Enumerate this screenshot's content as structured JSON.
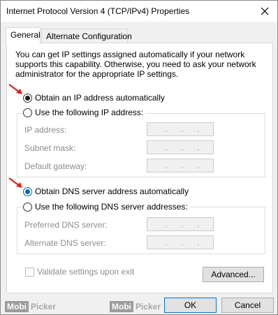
{
  "window": {
    "title": "Internet Protocol Version 4 (TCP/IPv4) Properties",
    "close_icon": "close-icon"
  },
  "tabs": [
    {
      "label": "General",
      "active": true
    },
    {
      "label": "Alternate Configuration",
      "active": false
    }
  ],
  "general": {
    "intro": "You can get IP settings assigned automatically if your network supports this capability. Otherwise, you need to ask your network administrator for the appropriate IP settings.",
    "ip_auto_label": "Obtain an IP address automatically",
    "ip_manual_label": "Use the following IP address:",
    "ip_fields": [
      {
        "label": "IP address:",
        "value": ". . ."
      },
      {
        "label": "Subnet mask:",
        "value": ". . ."
      },
      {
        "label": "Default gateway:",
        "value": ". . ."
      }
    ],
    "dns_auto_label": "Obtain DNS server address automatically",
    "dns_manual_label": "Use the following DNS server addresses:",
    "dns_fields": [
      {
        "label": "Preferred DNS server:",
        "value": ". . ."
      },
      {
        "label": "Alternate DNS server:",
        "value": ". . ."
      }
    ],
    "validate_label": "Validate settings upon exit",
    "advanced_label": "Advanced..."
  },
  "buttons": {
    "ok": "OK",
    "cancel": "Cancel"
  },
  "watermark": {
    "box_text": "Mobi",
    "text": "Picker"
  },
  "colors": {
    "accent": "#0078d7",
    "arrow": "#e02020"
  }
}
